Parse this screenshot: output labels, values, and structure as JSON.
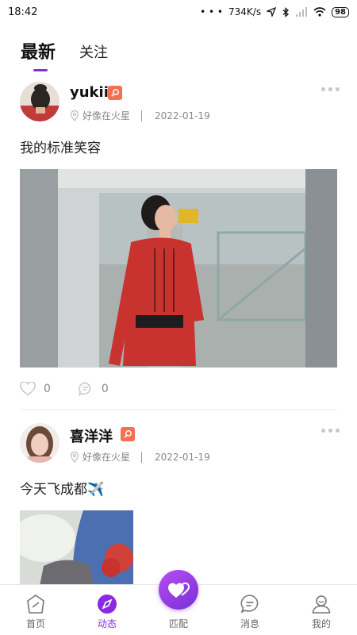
{
  "status_bar": {
    "time": "18:42",
    "dots": "• • •",
    "network_speed": "734K/s",
    "battery": "98"
  },
  "tabs": [
    {
      "label": "最新",
      "active": true
    },
    {
      "label": "关注",
      "active": false
    }
  ],
  "posts": [
    {
      "username": "yukii",
      "location": "好像在火星",
      "date": "2022-01-19",
      "text": "我的标准笑容",
      "likes": "0",
      "comments": "0"
    },
    {
      "username": "喜洋洋",
      "location": "好像在火星",
      "date": "2022-01-19",
      "text": "今天飞成都✈️"
    }
  ],
  "bottom_nav": [
    {
      "label": "首页",
      "icon": "home-icon"
    },
    {
      "label": "动态",
      "icon": "moments-icon",
      "active": true
    },
    {
      "label": "匹配",
      "icon": "match-heart-icon"
    },
    {
      "label": "消息",
      "icon": "message-icon"
    },
    {
      "label": "我的",
      "icon": "profile-icon"
    }
  ],
  "colors": {
    "accent": "#8a2be2",
    "badge": "#f4704f",
    "muted_text": "#888888"
  }
}
